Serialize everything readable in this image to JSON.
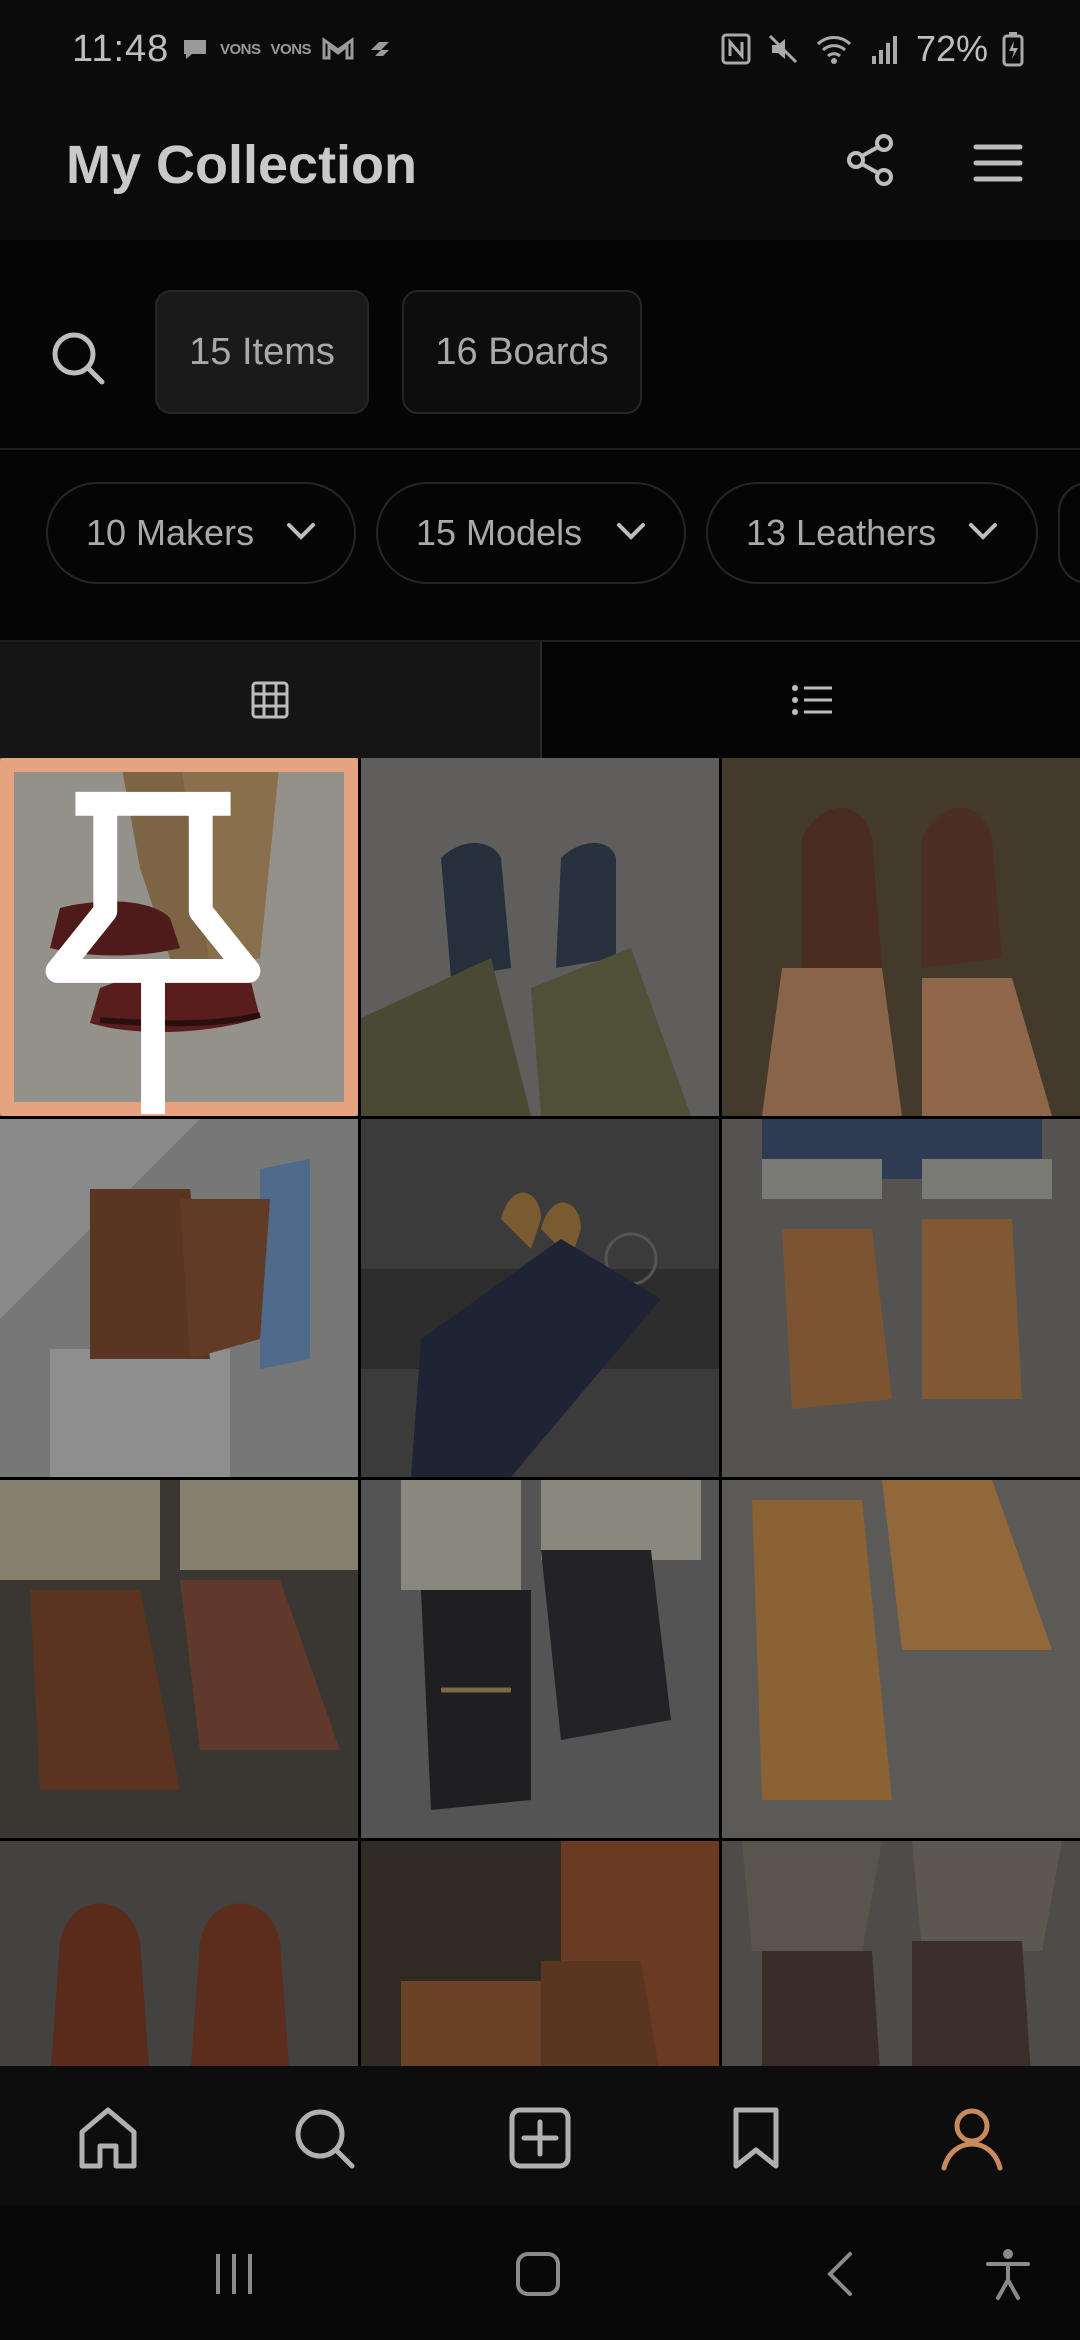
{
  "status_bar": {
    "time": "11:48",
    "carrier_1": "VONS",
    "carrier_2": "VONS",
    "battery": "72%"
  },
  "header": {
    "title": "My Collection",
    "share_icon": "share-icon",
    "menu_icon": "hamburger-menu-icon"
  },
  "segments": {
    "items_label": "15 Items",
    "boards_label": "16 Boards",
    "active": "items"
  },
  "filters": [
    {
      "label": "10 Makers"
    },
    {
      "label": "15 Models"
    },
    {
      "label": "13 Leathers"
    }
  ],
  "view_toggle": {
    "active": "grid",
    "grid_icon": "grid-view-icon",
    "list_icon": "list-view-icon"
  },
  "photos": [
    {
      "desc": "burgundy wingtip boots on sand",
      "pinned": true
    },
    {
      "desc": "navy lace-up boots on concrete",
      "pinned": false
    },
    {
      "desc": "brown leather sandals on grass",
      "pinned": false
    },
    {
      "desc": "brown side-zip boots on white plinth",
      "pinned": false
    },
    {
      "desc": "tan boots seen from above",
      "pinned": false
    },
    {
      "desc": "tan boots with cuffed denim",
      "pinned": false
    },
    {
      "desc": "brown engineer boots with chinos",
      "pinned": false
    },
    {
      "desc": "black cap-toe boots",
      "pinned": false
    },
    {
      "desc": "natural tan service boots",
      "pinned": false
    },
    {
      "desc": "red-brown boots from above",
      "pinned": false
    },
    {
      "desc": "brown boots on wood",
      "pinned": false
    },
    {
      "desc": "dark brown boots with tweed",
      "pinned": false
    }
  ],
  "bottom_nav": {
    "active": "profile",
    "accent": "#c98a5e",
    "inactive": "#b0b0b0"
  }
}
